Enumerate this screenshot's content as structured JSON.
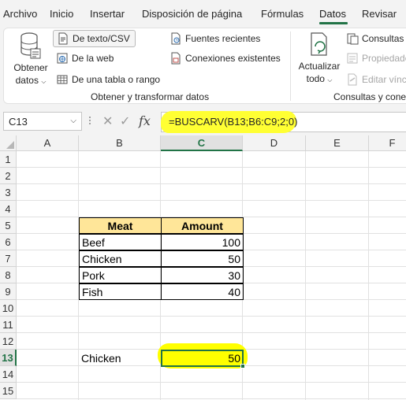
{
  "menu": {
    "tabs": [
      "Archivo",
      "Inicio",
      "Insertar",
      "Disposición de página",
      "Fórmulas",
      "Datos",
      "Revisar"
    ],
    "active_tab": "Datos"
  },
  "ribbon": {
    "obtener_datos": {
      "line1": "Obtener",
      "line2": "datos"
    },
    "de_texto_csv": "De texto/CSV",
    "de_la_web": "De la web",
    "de_tabla_rango": "De una tabla o rango",
    "fuentes_recientes": "Fuentes recientes",
    "conexiones_existentes": "Conexiones existentes",
    "group_obtener": "Obtener y transformar datos",
    "actualizar_todo": {
      "line1": "Actualizar",
      "line2": "todo"
    },
    "consultas": "Consultas y",
    "propiedades": "Propiedade",
    "editar_vinculos": "Editar vínc",
    "group_consultas": "Consultas y conex"
  },
  "formula_bar": {
    "name_box": "C13",
    "formula": "=BUSCARV(B13;B6:C9;2;0)"
  },
  "sheet": {
    "columns": [
      "A",
      "B",
      "C",
      "D",
      "E",
      "F"
    ],
    "rows": [
      "1",
      "2",
      "3",
      "4",
      "5",
      "6",
      "7",
      "8",
      "9",
      "10",
      "11",
      "12",
      "13",
      "14",
      "15"
    ],
    "active_cell": "C13",
    "table": {
      "headers": [
        "Meat",
        "Amount"
      ],
      "rows": [
        {
          "meat": "Beef",
          "amount": "100"
        },
        {
          "meat": "Chicken",
          "amount": "50"
        },
        {
          "meat": "Pork",
          "amount": "30"
        },
        {
          "meat": "Fish",
          "amount": "40"
        }
      ]
    },
    "lookup_key": "Chicken",
    "lookup_result": "50"
  },
  "colors": {
    "accent": "#217346",
    "header_fill": "#ffe699",
    "highlight": "#ffff00"
  }
}
